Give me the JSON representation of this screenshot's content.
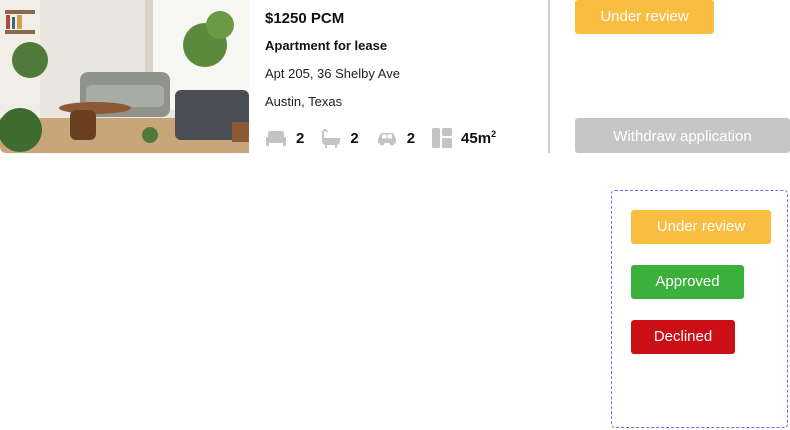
{
  "listing": {
    "price": "$1250 PCM",
    "property_type": "Apartment for lease",
    "address_line1": "Apt 205, 36 Shelby Ave",
    "address_line2": "Austin, Texas",
    "features": {
      "bedrooms": "2",
      "bathrooms": "2",
      "parking": "2",
      "area_value": "45m",
      "area_unit_sup": "2"
    },
    "icons": {
      "bed": "bed-icon",
      "bath": "bathtub-icon",
      "car": "car-icon",
      "area": "floorplan-icon"
    }
  },
  "status": {
    "label": "Under review",
    "color": "#f8bd41"
  },
  "actions": {
    "withdraw_label": "Withdraw application",
    "withdraw_color": "#c6c6c6"
  },
  "status_variants": [
    {
      "label": "Under review",
      "color": "#f8bd41"
    },
    {
      "label": "Approved",
      "color": "#3bb03b"
    },
    {
      "label": "Declined",
      "color": "#cc0e16"
    }
  ],
  "colors": {
    "icon_gray": "#c4c4c4",
    "divider": "#cfcfcf",
    "variant_border": "#7b61ff"
  }
}
